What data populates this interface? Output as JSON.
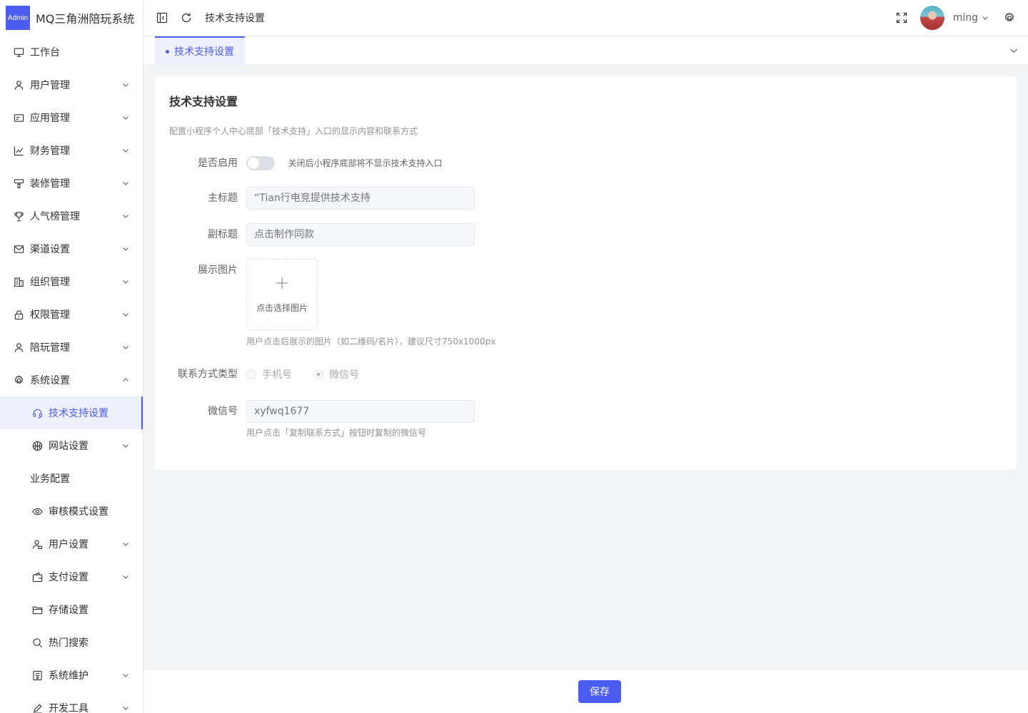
{
  "app": {
    "logo_text": "Admin",
    "title": "MQ三角洲陪玩系统"
  },
  "sidebar": {
    "items": [
      {
        "label": "工作台",
        "icon": "monitor-icon",
        "arrow": false
      },
      {
        "label": "用户管理",
        "icon": "user-icon",
        "arrow": "down"
      },
      {
        "label": "应用管理",
        "icon": "app-card-icon",
        "arrow": "down"
      },
      {
        "label": "财务管理",
        "icon": "chart-icon",
        "arrow": "down"
      },
      {
        "label": "装修管理",
        "icon": "brush-icon",
        "arrow": "down"
      },
      {
        "label": "人气榜管理",
        "icon": "trophy-icon",
        "arrow": "down"
      },
      {
        "label": "渠道设置",
        "icon": "message-icon",
        "arrow": "down"
      },
      {
        "label": "组织管理",
        "icon": "building-icon",
        "arrow": "down"
      },
      {
        "label": "权限管理",
        "icon": "lock-icon",
        "arrow": "down"
      },
      {
        "label": "陪玩管理",
        "icon": "user-icon",
        "arrow": "down"
      },
      {
        "label": "系统设置",
        "icon": "gear-icon",
        "arrow": "up"
      }
    ],
    "sub_items": [
      {
        "label": "技术支持设置",
        "icon": "headset-icon",
        "arrow": false,
        "active": true
      },
      {
        "label": "网站设置",
        "icon": "basketball-icon",
        "arrow": "down"
      },
      {
        "label": "业务配置",
        "icon": "",
        "arrow": false
      },
      {
        "label": "审核模式设置",
        "icon": "eye-icon",
        "arrow": false
      },
      {
        "label": "用户设置",
        "icon": "user-settings-icon",
        "arrow": "down"
      },
      {
        "label": "支付设置",
        "icon": "wallet-icon",
        "arrow": "down"
      },
      {
        "label": "存储设置",
        "icon": "folder-icon",
        "arrow": false
      },
      {
        "label": "热门搜索",
        "icon": "search-icon",
        "arrow": false
      },
      {
        "label": "系统维护",
        "icon": "maintenance-icon",
        "arrow": "down"
      },
      {
        "label": "开发工具",
        "icon": "edit-pen-icon",
        "arrow": "down"
      }
    ]
  },
  "header": {
    "breadcrumb": "技术支持设置",
    "username": "ming"
  },
  "tabs": [
    {
      "label": "技术支持设置",
      "active": true
    }
  ],
  "form": {
    "title": "技术支持设置",
    "description": "配置小程序个人中心底部「技术支持」入口的显示内容和联系方式",
    "enable": {
      "label": "是否启用",
      "value": false,
      "hint": "关闭后小程序底部将不显示技术支持入口"
    },
    "main_title": {
      "label": "主标题",
      "placeholder": "“Tian行电竞提供技术支持"
    },
    "sub_title": {
      "label": "副标题",
      "placeholder": "点击制作同款"
    },
    "image": {
      "label": "展示图片",
      "upload_text": "点击选择图片",
      "hint": "用户点击后展示的图片（如二维码/名片），建议尺寸750x1000px"
    },
    "contact_type": {
      "label": "联系方式类型",
      "options": [
        "手机号",
        "微信号"
      ],
      "selected": "微信号"
    },
    "wechat": {
      "label": "微信号",
      "placeholder": "xyfwq1677",
      "hint": "用户点击「复制联系方式」按钮时复制的微信号"
    }
  },
  "footer": {
    "save_label": "保存"
  },
  "colors": {
    "primary": "#4b5cf0",
    "active_bg": "#eef0fd",
    "page_bg": "#f2f3f5"
  }
}
